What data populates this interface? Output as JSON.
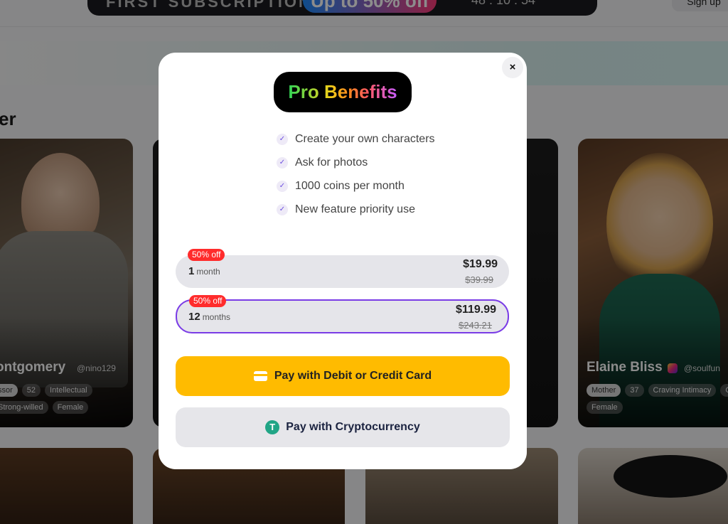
{
  "promo": {
    "text": "FIRST SUBSCRIPTION",
    "highlight": "Up to 50% off",
    "timer": "48 : 10 : 54",
    "signup_label": "Sign up"
  },
  "section": {
    "title": "er"
  },
  "cards": [
    {
      "name": "ontgomery",
      "handle": "@nino129",
      "tags": [
        "ssor",
        "52",
        "Intellectual",
        "Strong-willed",
        "Female"
      ]
    },
    {
      "name": "Elaine Bliss",
      "handle": "@soulfun",
      "tags": [
        "Mother",
        "37",
        "Craving Intimacy",
        "Ou",
        "Female"
      ]
    }
  ],
  "modal": {
    "close_label": "×",
    "badge": "Pro Benefits",
    "benefits": [
      "Create your own characters",
      "Ask for photos",
      "1000 coins per month",
      "New feature priority use"
    ],
    "check_glyph": "✓",
    "plans": [
      {
        "badge": "50% off",
        "qty": "1",
        "unit": "month",
        "price": "$19.99",
        "old_price": "$39.99",
        "selected": false
      },
      {
        "badge": "50% off",
        "qty": "12",
        "unit": "months",
        "price": "$119.99",
        "old_price": "$243.21",
        "selected": true
      }
    ],
    "pay_card_label": "Pay with Debit or Credit Card",
    "pay_crypto_label": "Pay with Cryptocurrency",
    "tether_glyph": "T"
  },
  "colors": {
    "accent_yellow": "#ffbb00",
    "selected_border": "#7a3ce6",
    "discount_red": "#ff2c2c",
    "tether_green": "#21a586"
  },
  "icons": [
    "close-icon",
    "check-icon",
    "credit-card-icon",
    "tether-icon",
    "instagram-icon"
  ]
}
